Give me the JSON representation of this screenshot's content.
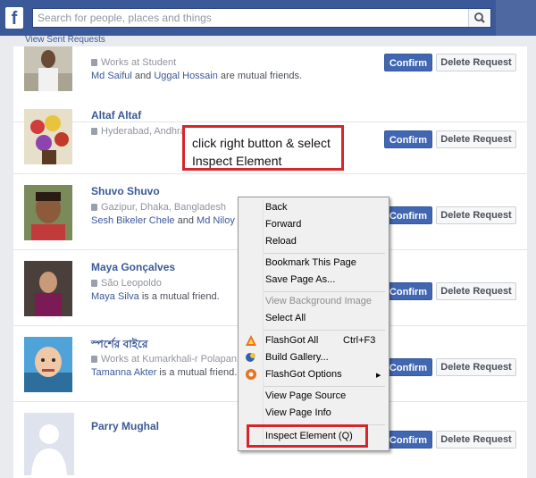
{
  "header": {
    "logo": "f",
    "search_placeholder": "Search for people, places and things"
  },
  "sent_requests_link": "View Sent Requests",
  "requests": [
    {
      "name": "",
      "meta": "Works at Student",
      "mutual_a": "Md Saiful",
      "mutual_mid": " and ",
      "mutual_b": "Uggal Hossain",
      "mutual_tail": " are mutual friends.",
      "confirm": "Confirm",
      "delete": "Delete Request"
    },
    {
      "name": "Altaf Altaf",
      "meta": "Hyderabad, Andhra Pradesh",
      "mutual_a": "",
      "mutual_mid": "",
      "mutual_b": "",
      "mutual_tail": "",
      "confirm": "Confirm",
      "delete": "Delete Request"
    },
    {
      "name": "Shuvo Shuvo",
      "meta": "Gazipur, Dhaka, Bangladesh",
      "mutual_a": "Sesh Bikeler Chele",
      "mutual_mid": " and ",
      "mutual_b": "Md Niloy a",
      "mutual_tail": "",
      "confirm": "Confirm",
      "delete": "Delete Request"
    },
    {
      "name": "Maya Gonçalves",
      "meta": "São Leopoldo",
      "mutual_a": "Maya Silva",
      "mutual_mid": "",
      "mutual_b": "",
      "mutual_tail": " is a mutual friend.",
      "confirm": "Confirm",
      "delete": "Delete Request"
    },
    {
      "name": "স্পর্শের বাইরে",
      "meta": "Works at Kumarkhali-r Polapan",
      "mutual_a": "Tamanna Akter",
      "mutual_mid": "",
      "mutual_b": "",
      "mutual_tail": " is a mutual friend.",
      "confirm": "Confirm",
      "delete": "Delete Request"
    },
    {
      "name": "Parry Mughal",
      "meta": "",
      "mutual_a": "",
      "mutual_mid": "",
      "mutual_b": "",
      "mutual_tail": "",
      "confirm": "Confirm",
      "delete": "Delete Request"
    }
  ],
  "context_menu": {
    "items": [
      {
        "label": "Back",
        "disabled": false
      },
      {
        "label": "Forward",
        "disabled": false
      },
      {
        "label": "Reload",
        "disabled": false
      },
      {
        "label": "Bookmark This Page",
        "disabled": false
      },
      {
        "label": "Save Page As...",
        "disabled": false
      },
      {
        "label": "View Background Image",
        "disabled": true
      },
      {
        "label": "Select All",
        "disabled": false
      },
      {
        "label": "FlashGot All",
        "shortcut": "Ctrl+F3",
        "icon": "flashgot-icon"
      },
      {
        "label": "Build Gallery...",
        "icon": "build-gallery-icon"
      },
      {
        "label": "FlashGot Options",
        "icon": "flashgot-options-icon",
        "submenu": true
      },
      {
        "label": "View Page Source",
        "disabled": false
      },
      {
        "label": "View Page Info",
        "disabled": false
      },
      {
        "label": "Inspect Element (Q)",
        "disabled": false
      }
    ]
  },
  "annotation": {
    "text": "click right button & select Inspect Element",
    "color": "#d6262c"
  },
  "colors": {
    "brand": "#3b5998",
    "confirm": "#4267b2"
  }
}
